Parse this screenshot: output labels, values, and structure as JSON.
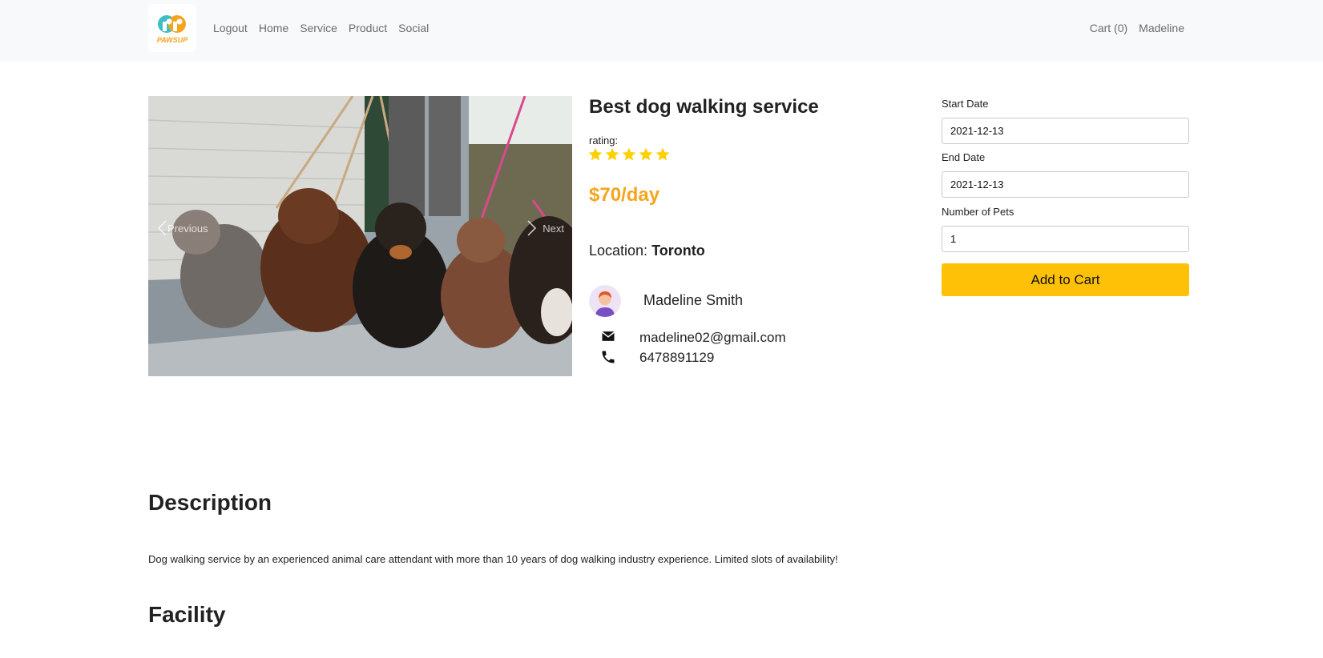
{
  "brand": {
    "logo_text": "PAWSUP",
    "accent": "#f7a41d",
    "teal": "#3dbdc6"
  },
  "nav": {
    "left": [
      "Logout",
      "Home",
      "Service",
      "Product",
      "Social"
    ],
    "cart": "Cart (0)",
    "user": "Madeline"
  },
  "carousel": {
    "prev_label": "Previous",
    "next_label": "Next",
    "prev_icon": "chevron-left-icon",
    "next_icon": "chevron-right-icon"
  },
  "service": {
    "title": "Best dog walking service",
    "rating_label": "rating:",
    "rating": 5,
    "rating_max": 5,
    "star_color": "#ffd000",
    "price": "$70/day",
    "location_label": "Location:",
    "location_value": "Toronto"
  },
  "owner": {
    "name": "Madeline Smith",
    "email": "madeline02@gmail.com",
    "phone": "6478891129",
    "email_icon": "mail-icon",
    "phone_icon": "phone-icon"
  },
  "booking": {
    "start_label": "Start Date",
    "start_value": "2021-12-13",
    "end_label": "End Date",
    "end_value": "2021-12-13",
    "pets_label": "Number of Pets",
    "pets_value": "1",
    "button_label": "Add to Cart",
    "button_color": "#ffc107"
  },
  "sections": {
    "description_heading": "Description",
    "description_text": "Dog walking service by an experienced animal care attendant with more than 10 years of dog walking industry experience. Limited slots of availability!",
    "facility_heading": "Facility"
  }
}
